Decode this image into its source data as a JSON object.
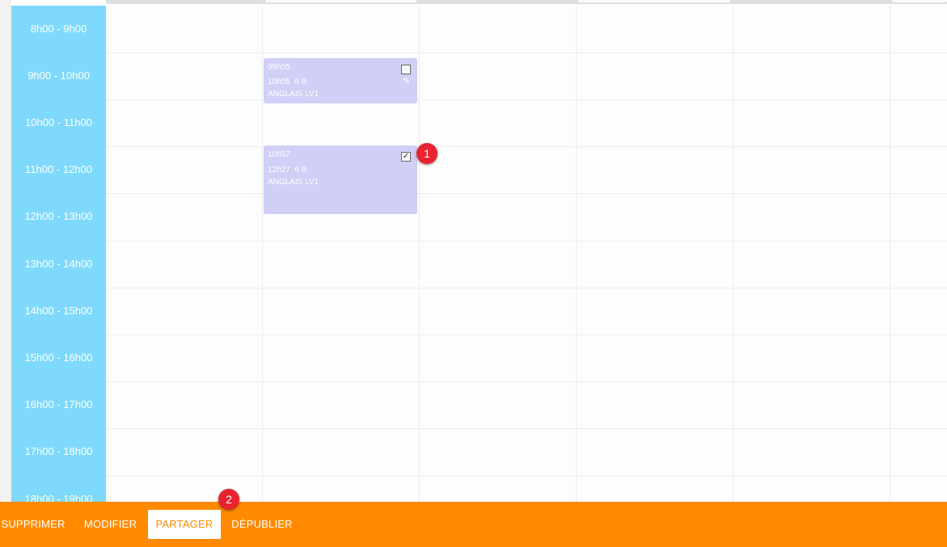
{
  "time_slots": [
    "8h00 - 9h00",
    "9h00 - 10h00",
    "10h00 - 11h00",
    "11h00 - 12h00",
    "12h00 - 13h00",
    "13h00 - 14h00",
    "14h00 - 15h00",
    "15h00 - 16h00",
    "16h00 - 17h00",
    "17h00 - 18h00",
    "18h00 - 19h00"
  ],
  "events": [
    {
      "start": "09h05",
      "end": "10h05",
      "class": "6 B",
      "subject": "ANGLAIS LV1",
      "checked": false,
      "checkbox_symbol": "",
      "has_edit": true
    },
    {
      "start": "10h57",
      "end": "12h27",
      "class": "6 B",
      "subject": "ANGLAIS LV1",
      "checked": true,
      "checkbox_symbol": "✓",
      "has_edit": false
    }
  ],
  "badges": {
    "badge1": "1",
    "badge2": "2"
  },
  "toolbar": {
    "supprimer": "SUPPRIMER",
    "modifier": "MODIFIER",
    "partager": "PARTAGER",
    "depublier": "DÉPUBLIER",
    "active": "partager"
  },
  "colors": {
    "time_column": "#7fd9fc",
    "event": "#d0cff6",
    "toolbar": "#ff8a00",
    "badge": "#e8232f"
  }
}
